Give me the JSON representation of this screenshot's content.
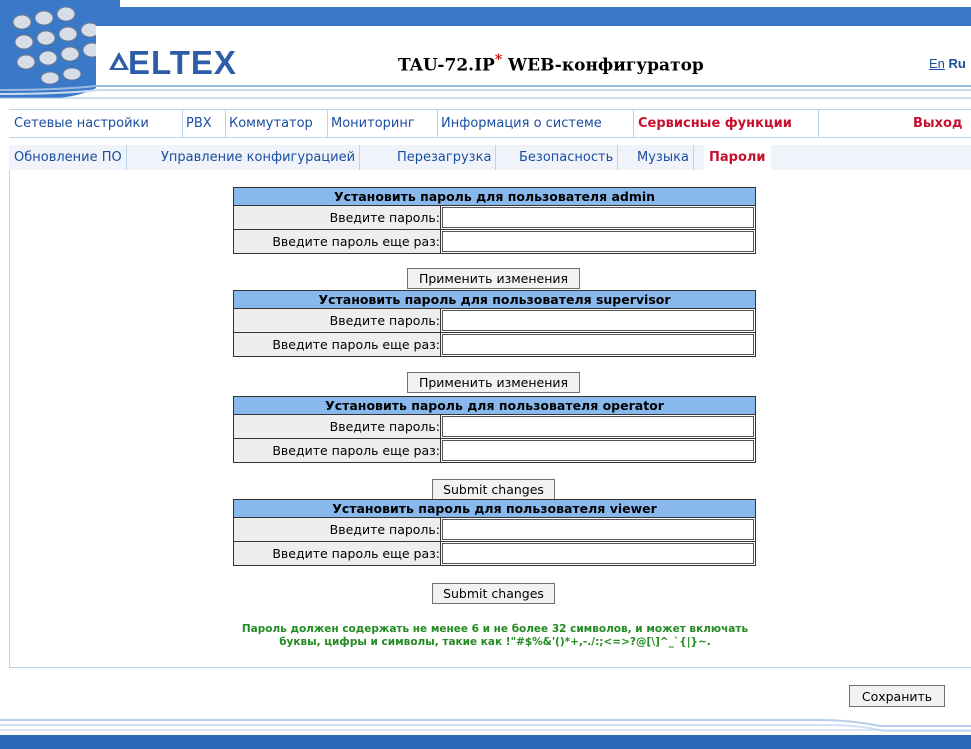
{
  "header": {
    "logo_text": "ELTEX",
    "title_model": "TAU-72.IP",
    "title_star": "*",
    "title_suffix": " WEB-конфигуратор",
    "lang_en": "En",
    "lang_ru": "Ru"
  },
  "menu": {
    "items": [
      "Сетевые настройки",
      "PBX",
      "Коммутатор",
      "Мониторинг",
      "Информация о системе",
      "Сервисные функции"
    ],
    "active_index": 5,
    "exit_label": "Выход"
  },
  "submenu": {
    "items": [
      "Обновление ПО",
      "Управление конфигурацией",
      "Перезагрузка",
      "Безопасность",
      "Музыка",
      "Пароли"
    ],
    "active_index": 5
  },
  "password_blocks": [
    {
      "title": "Установить пароль для пользователя admin",
      "label1": "Введите пароль:",
      "label2": "Введите пароль еще раз:",
      "value1": "",
      "value2": "",
      "button": "Применить изменения"
    },
    {
      "title": "Установить пароль для пользователя supervisor",
      "label1": "Введите пароль:",
      "label2": "Введите пароль еще раз:",
      "value1": "",
      "value2": "",
      "button": "Применить изменения"
    },
    {
      "title": "Установить пароль для пользователя operator",
      "label1": "Введите пароль:",
      "label2": "Введите пароль еще раз:",
      "value1": "",
      "value2": "",
      "button": "Submit changes"
    },
    {
      "title": "Установить пароль для пользователя viewer",
      "label1": "Введите пароль:",
      "label2": "Введите пароль еще раз:",
      "value1": "",
      "value2": "",
      "button": "Submit changes"
    }
  ],
  "note": {
    "line1": "Пароль должен содержать не менее 6 и не более 32 символов, и может включать",
    "line2": "буквы, цифры и символы, такие как !\"#$%&'()*+,-./:;<=>?@[\\]^_`{|}~."
  },
  "save_button": "Сохранить",
  "colors": {
    "brand_blue": "#3a78c8",
    "table_header": "#89b9ec",
    "active_red": "#c8102e",
    "note_green": "#228b22"
  }
}
